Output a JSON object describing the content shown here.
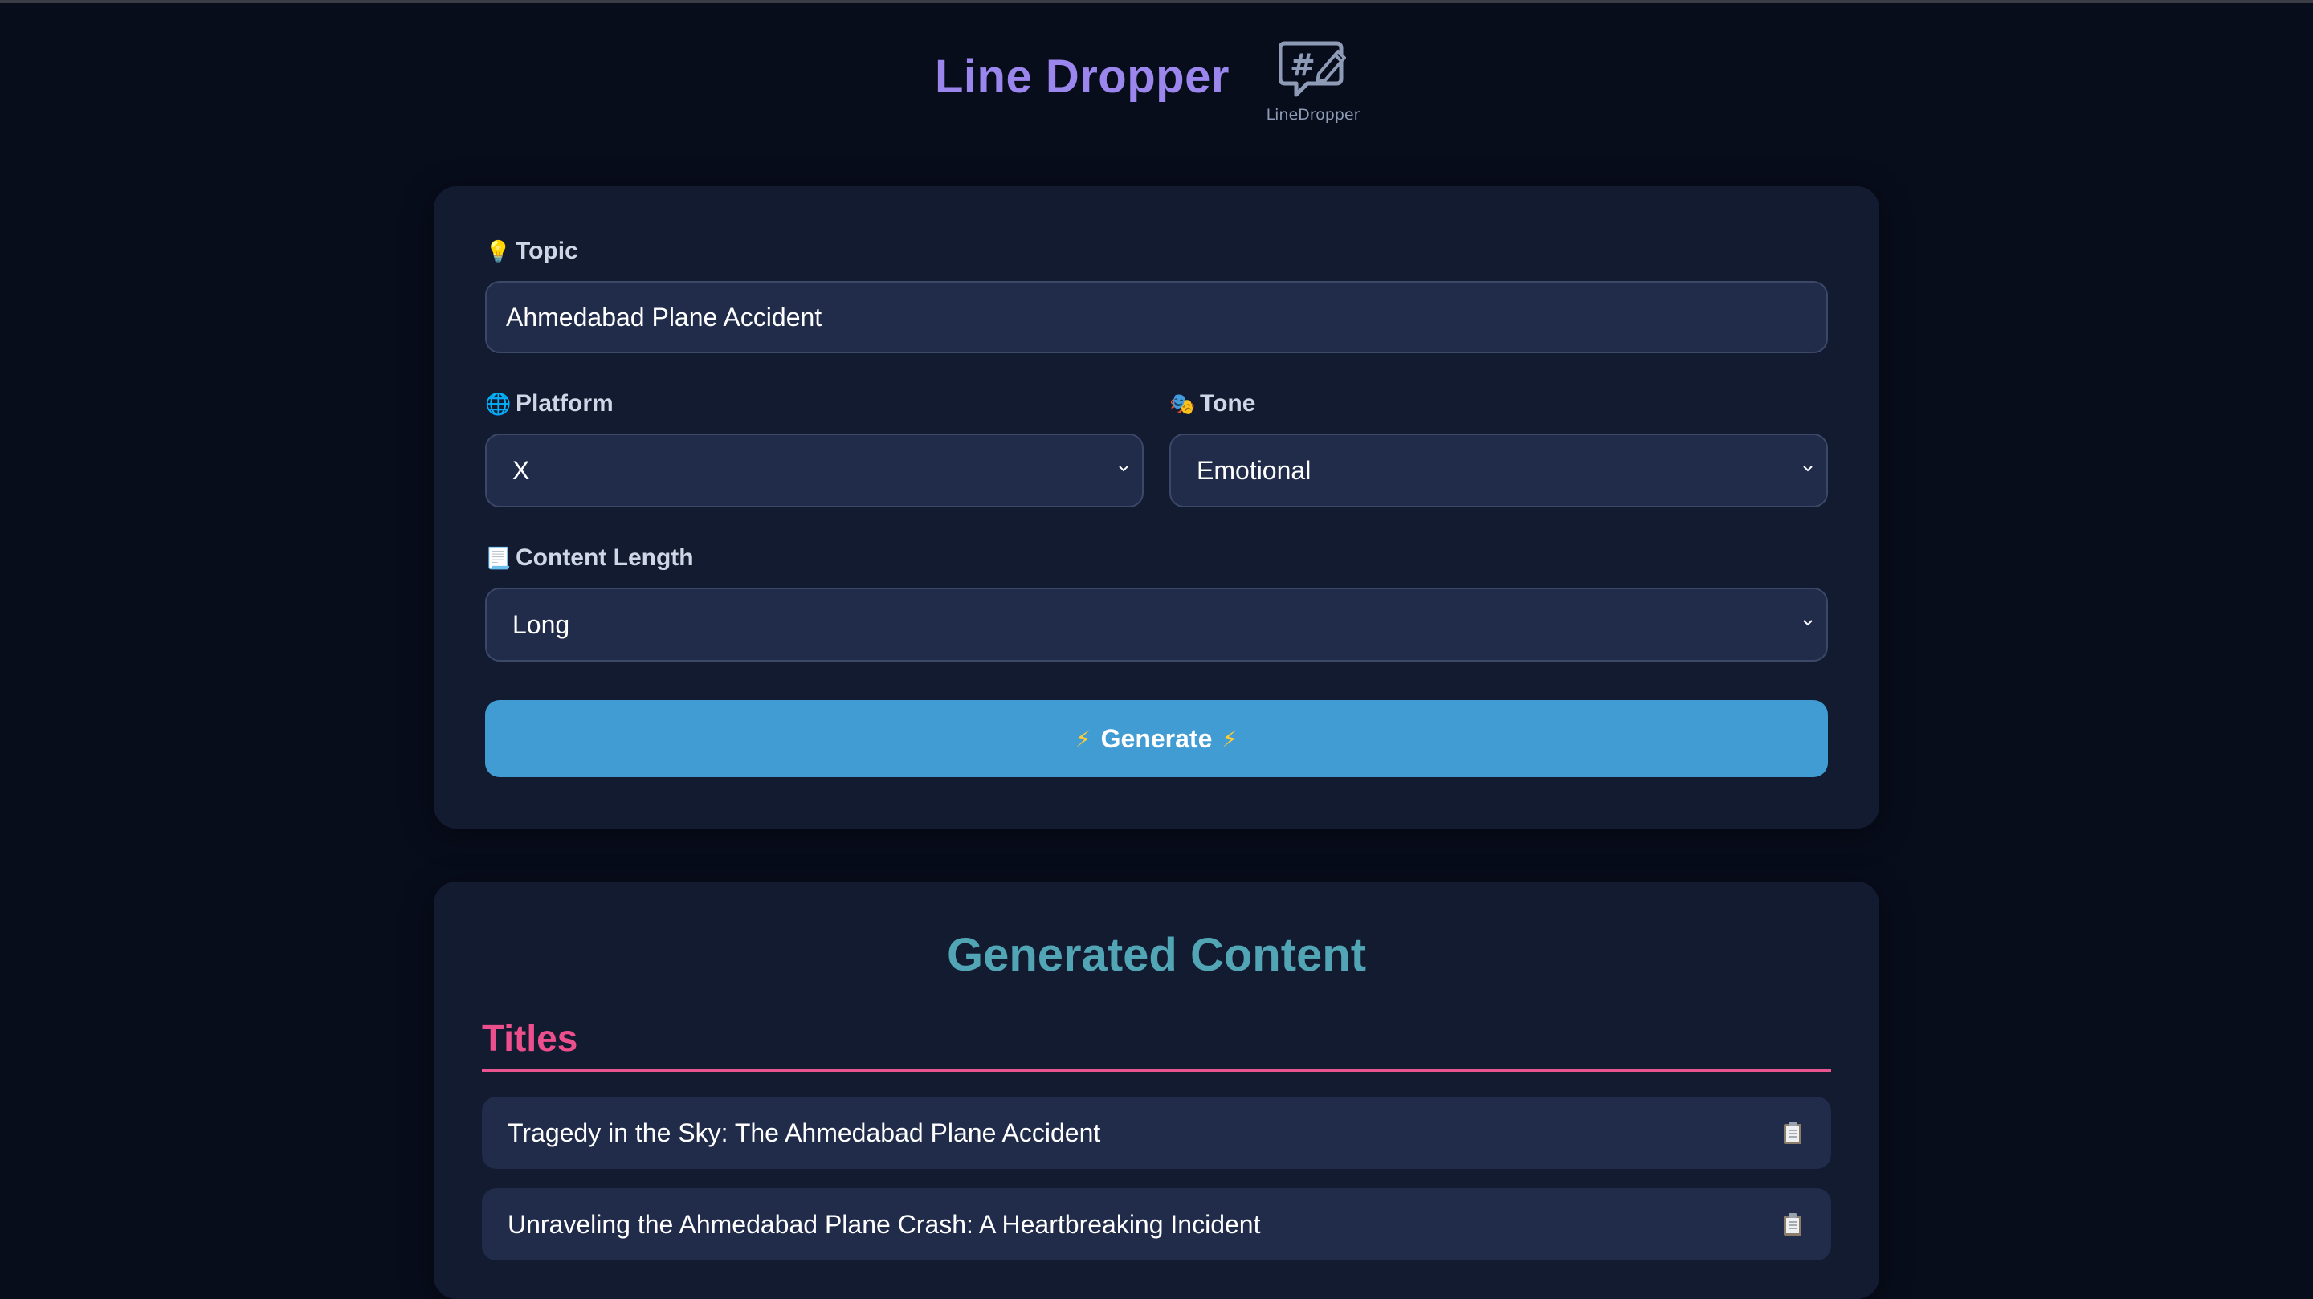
{
  "header": {
    "title": "Line Dropper",
    "logo_text": "LineDropper",
    "logo_icon": "hashtag-chat-pencil-icon"
  },
  "form": {
    "topic": {
      "icon": "lightbulb-icon",
      "emoji": "💡",
      "label": "Topic",
      "value": "Ahmedabad Plane Accident"
    },
    "platform": {
      "icon": "globe-icon",
      "emoji": "🌐",
      "label": "Platform",
      "value": "X"
    },
    "tone": {
      "icon": "theater-masks-icon",
      "emoji": "🎭",
      "label": "Tone",
      "value": "Emotional"
    },
    "length": {
      "icon": "scroll-icon",
      "emoji": "📃",
      "label": "Content Length",
      "value": "Long"
    },
    "generate": {
      "label": "Generate",
      "icon": "lightning-icon",
      "emoji": "⚡"
    }
  },
  "output": {
    "title": "Generated Content",
    "titles_section": "Titles",
    "titles": [
      "Tragedy in the Sky: The Ahmedabad Plane Accident",
      "Unraveling the Ahmedabad Plane Crash: A Heartbreaking Incident"
    ],
    "copy_icon": "clipboard-icon"
  },
  "colors": {
    "background": "#080d1c",
    "card": "#131b31",
    "field": "#212c4b",
    "brand": "#9b86ee",
    "accent_teal": "#52a5b5",
    "accent_pink": "#ec4f8b",
    "button": "#419cd3"
  }
}
